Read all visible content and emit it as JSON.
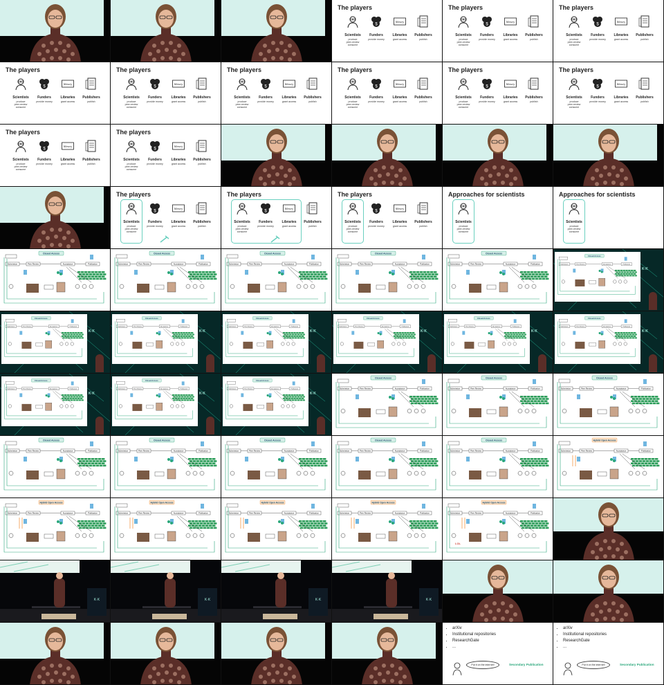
{
  "columns": 6,
  "rows": 11,
  "cells": [
    "speaker",
    "speaker",
    "speaker",
    "players",
    "players",
    "players",
    "players",
    "players",
    "players",
    "players",
    "players",
    "players",
    "players",
    "players",
    "speaker",
    "speaker",
    "speaker",
    "speaker",
    "speaker",
    "players-hl-sci",
    "players-hl-all",
    "players-hl-sci2",
    "approach",
    "approach",
    "diagram",
    "diagram",
    "diagram",
    "diagram",
    "diagram",
    "diagram-matrix",
    "diagram-matrix",
    "diagram-matrix",
    "diagram-matrix",
    "diagram-matrix",
    "diagram-matrix",
    "diagram-matrix",
    "diagram-matrix",
    "diagram-matrix",
    "diagram-matrix",
    "diagram",
    "diagram",
    "diagram",
    "diagram",
    "diagram",
    "diagram",
    "diagram",
    "diagram",
    "diagram-hybrid",
    "diagram-hybrid",
    "diagram-hybrid",
    "diagram-hybrid",
    "diagram-hybrid",
    "diagram-hybrid-lol",
    "speaker-wide",
    "stage",
    "stage",
    "stage",
    "stage",
    "speaker-wide",
    "speaker-wide",
    "speaker",
    "speaker",
    "speaker",
    "speaker",
    "list",
    "list"
  ],
  "slides": {
    "players_title": "The players",
    "approach_title": "Approaches for scientists",
    "players": [
      {
        "name": "Scientists",
        "desc": "produce\npeer-review\nconsume",
        "icon": "scientist-icon"
      },
      {
        "name": "Funders",
        "desc": "provide money",
        "icon": "money-icon"
      },
      {
        "name": "Libraries",
        "desc": "grant access",
        "icon": "library-icon"
      },
      {
        "name": "Publishers",
        "desc": "publish",
        "icon": "publisher-icon"
      }
    ],
    "library_word": "library"
  },
  "diagram": {
    "closed_title": "Closed Access",
    "hybrid_title": "Hybrid Open Access",
    "submission": "Submission",
    "peer_review": "Peer Review",
    "acceptance": "Acceptance",
    "publication": "Publication",
    "lol": "LOL",
    "colors": {
      "accent": "#2aa77b",
      "wall": "#2e9e5b",
      "hybrid": "#f2994a",
      "box": "#333333"
    }
  },
  "list": {
    "items": [
      "arXiv",
      "Institutional repositories",
      "ResearchGate",
      "..."
    ],
    "bubble": "Put it on the internet!",
    "label": "Secondary Publication"
  },
  "colors": {
    "screen": "#d6f1ec",
    "dress": "#5a2e28",
    "skin": "#e6b89a",
    "hair": "#7a5236",
    "teal": "#6ad0bf"
  }
}
